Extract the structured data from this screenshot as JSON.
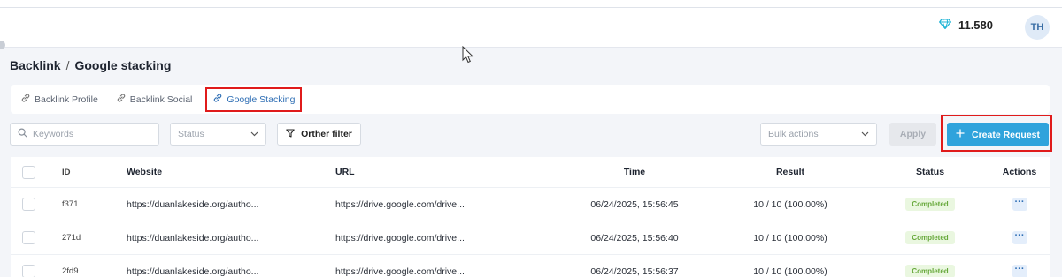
{
  "header": {
    "credits": "11.580",
    "avatar_initials": "TH",
    "gem_color": "#22b5d6"
  },
  "breadcrumb": {
    "root": "Backlink",
    "separator": "/",
    "current": "Google stacking"
  },
  "tabs": [
    {
      "label": "Backlink Profile",
      "active": false,
      "icon": "link-icon"
    },
    {
      "label": "Backlink Social",
      "active": false,
      "icon": "link-icon"
    },
    {
      "label": "Google Stacking",
      "active": true,
      "icon": "link-icon"
    }
  ],
  "toolbar": {
    "search_placeholder": "Keywords",
    "status_placeholder": "Status",
    "other_filter_label": "Orther filter",
    "bulk_actions_placeholder": "Bulk actions",
    "apply_label": "Apply",
    "create_label": "Create Request",
    "accent_color": "#2fa3dc"
  },
  "table": {
    "columns": [
      "ID",
      "Website",
      "URL",
      "Time",
      "Result",
      "Status",
      "Actions"
    ],
    "rows": [
      {
        "id": "f371",
        "website": "https://duanlakeside.org/autho...",
        "url": "https://drive.google.com/drive...",
        "time": "06/24/2025, 15:56:45",
        "result": "10 / 10 (100.00%)",
        "status": "Completed",
        "action": "···"
      },
      {
        "id": "271d",
        "website": "https://duanlakeside.org/autho...",
        "url": "https://drive.google.com/drive...",
        "time": "06/24/2025, 15:56:40",
        "result": "10 / 10 (100.00%)",
        "status": "Completed",
        "action": "···"
      },
      {
        "id": "2fd9",
        "website": "https://duanlakeside.org/autho...",
        "url": "https://drive.google.com/drive...",
        "time": "06/24/2025, 15:56:37",
        "result": "10 / 10 (100.00%)",
        "status": "Completed",
        "action": "···"
      }
    ]
  }
}
